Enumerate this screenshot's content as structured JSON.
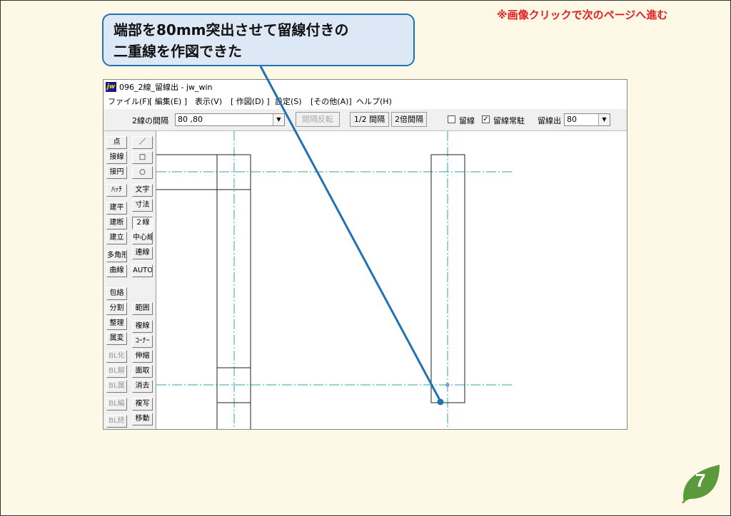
{
  "notice": "※画像クリックで次のページへ進む",
  "callout": {
    "line1": "端部を80mm突出させて留線付きの",
    "line2": "二重線を作図できた"
  },
  "window": {
    "logo": "jw",
    "title": "096_2線_留線出 - jw_win"
  },
  "menu": [
    "ファイル(F)",
    "[ 編集(E) ]",
    "表示(V)",
    "[ 作図(D) ]",
    "設定(S)",
    "[その他(A)]",
    "ヘルプ(H)"
  ],
  "toolbar": {
    "spacing_label": "2線の間隔",
    "spacing_value": "80 ,80",
    "invert_button": "間隔反転",
    "half_button": "1/2 間隔",
    "double_button": "2倍間隔",
    "tome_label": "留線",
    "tome_check": "",
    "constant_label": "留線常駐",
    "constant_check": "✓",
    "extend_label": "留線出",
    "extend_value": "80"
  },
  "left_col1": [
    "点",
    "接線",
    "接円",
    "ﾊｯﾁ",
    "建平",
    "建断",
    "建立",
    "多角形",
    "曲線",
    "包絡",
    "分割",
    "整理",
    "属変",
    "BL化",
    "BL解",
    "BL属",
    "BL編",
    "BL終"
  ],
  "left_col2": [
    "／",
    "□",
    "○",
    "文字",
    "寸法",
    "２線",
    "中心線",
    "連線",
    "AUTO",
    "範囲",
    "複線",
    "ｺｰﾅｰ",
    "伸縮",
    "面取",
    "消去",
    "複写",
    "移動"
  ],
  "page_number": "7",
  "colors": {
    "accent": "#2171b5",
    "notice": "#e02020",
    "leaf": "#5a9a3c",
    "center_line": "#2aa8a8",
    "slide_bg": "#fdf9e6"
  }
}
